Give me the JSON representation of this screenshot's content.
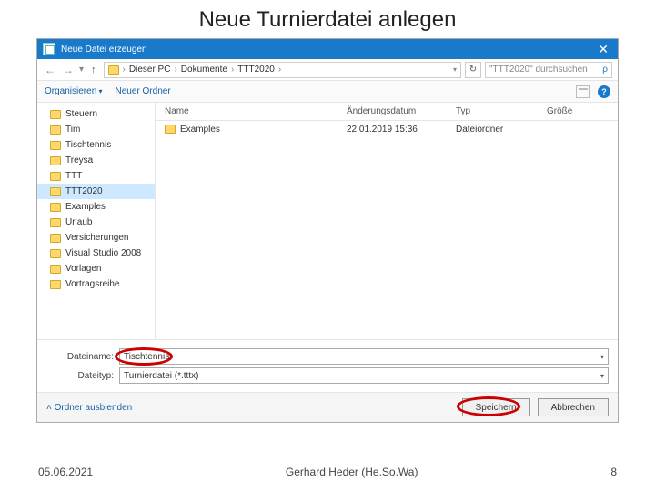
{
  "slide": {
    "title": "Neue Turnierdatei anlegen",
    "date": "05.06.2021",
    "author": "Gerhard Heder (He.So.Wa)",
    "page": "8"
  },
  "dialog": {
    "title": "Neue Datei erzeugen",
    "close": "✕",
    "nav": {
      "back": "←",
      "fwd": "→",
      "up": "↑",
      "refresh": "↻",
      "crumbs": [
        "Dieser PC",
        "Dokumente",
        "TTT2020"
      ],
      "sep": "›"
    },
    "search": {
      "placeholder": "\"TTT2020\" durchsuchen",
      "icon": "🔍"
    },
    "toolbar": {
      "organize": "Organisieren",
      "newfolder": "Neuer Ordner",
      "help": "?"
    },
    "columns": {
      "name": "Name",
      "date": "Änderungsdatum",
      "type": "Typ",
      "size": "Größe"
    },
    "tree": [
      "Steuern",
      "Tim",
      "Tischtennis",
      "Treysa",
      "TTT",
      "TTT2020",
      "Examples",
      "Urlaub",
      "Versicherungen",
      "Visual Studio 2008",
      "Vorlagen",
      "Vortragsreihe"
    ],
    "tree_selected": "TTT2020",
    "files": [
      {
        "name": "Examples",
        "date": "22.01.2019 15:36",
        "type": "Dateiordner",
        "size": ""
      }
    ],
    "filename_label": "Dateiname:",
    "filename_value": "Tischtennis",
    "filetype_label": "Dateityp:",
    "filetype_value": "Turnierdatei (*.tttx)",
    "hide_folders": "Ordner ausblenden",
    "save": "Speichern",
    "cancel": "Abbrechen"
  }
}
